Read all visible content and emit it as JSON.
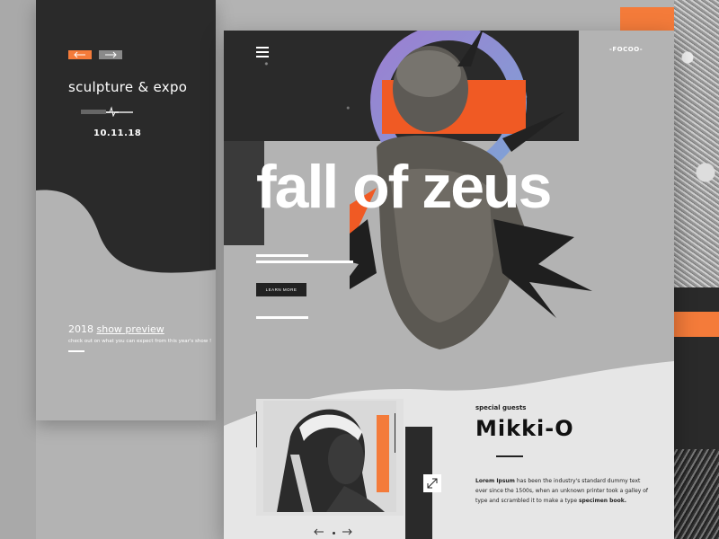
{
  "colors": {
    "accent": "#f47b3a",
    "dark": "#2a2a2a",
    "gray": "#b3b3b3",
    "light": "#e6e6e6"
  },
  "left_card": {
    "title": "sculpture & expo",
    "date": "10.11.18",
    "year": "2018",
    "preview_link": "show preview",
    "description": "check out on what you can expect from this year's show !"
  },
  "main_card": {
    "brand": "-FOCOO-",
    "title": "fall of zeus",
    "learn_more": "LEARN MORE",
    "guests_label": "special guests",
    "guest_name": "Mikki-O",
    "desc_bold_1": "Lorem Ipsum",
    "desc_text": " has been the industry's standard dummy text ever since the 1500s, when an unknown printer took a galley of type and scrambled it to make a type ",
    "desc_bold_2": "specimen book."
  },
  "icons": {
    "menu": "hamburger-icon",
    "expand": "expand-icon",
    "prev": "arrow-left-icon",
    "next": "arrow-right-icon"
  }
}
